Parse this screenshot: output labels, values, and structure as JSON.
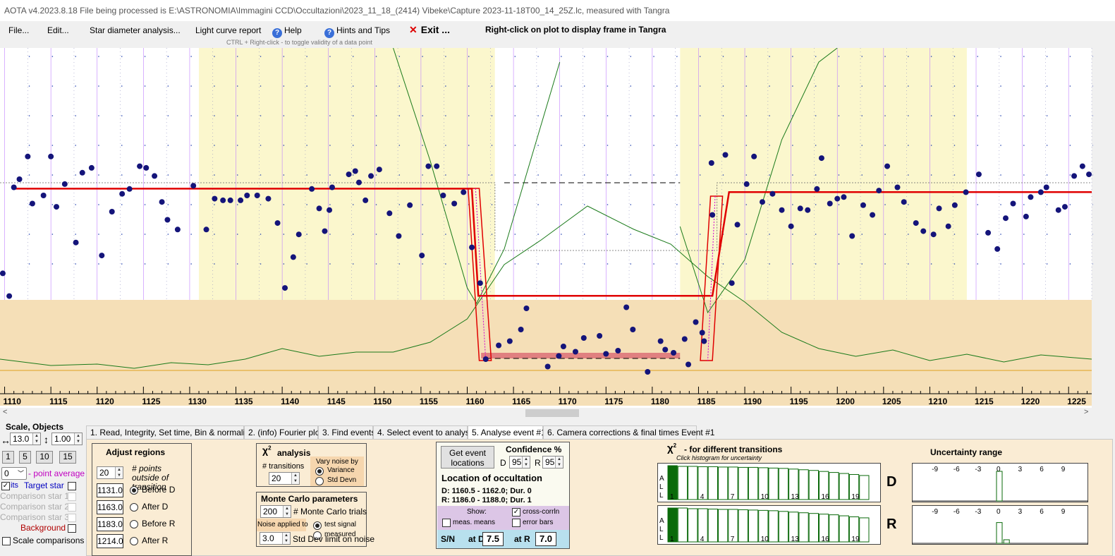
{
  "window": {
    "title": "AOTA v4.2023.8.18    File being processed is E:\\ASTRONOMIA\\Immagini CCD\\Occultazioni\\2023_11_18_(2414) Vibeke\\Capture 2023-11-18T00_14_25Z.lc, measured with Tangra"
  },
  "menu": {
    "file": "File...",
    "edit": "Edit...",
    "star_diameter": "Star diameter analysis...",
    "light_curve": "Light curve report",
    "help": "Help",
    "hints": "Hints and Tips",
    "exit": "Exit ...",
    "right_click": "Right-click on plot to display frame in Tangra",
    "ctrl_hint": "CTRL + Right-click  -  to toggle validity of a data point"
  },
  "colors": {
    "data_point": "#14147a",
    "fit_line": "#e00000",
    "background_curve": "#1a7a1a",
    "region_yellow": "#fbf7cd",
    "region_tan": "#f5dfb7",
    "event_bar": "#e08080"
  },
  "chart_data": {
    "type": "scatter",
    "xlim": [
      1109.5,
      1227.5
    ],
    "xticks": [
      1110,
      1115,
      1120,
      1125,
      1130,
      1135,
      1140,
      1145,
      1150,
      1155,
      1160,
      1165,
      1170,
      1175,
      1180,
      1185,
      1190,
      1195,
      1200,
      1205,
      1210,
      1215,
      1220,
      1225
    ],
    "points": [
      [
        1109.8,
        0.78
      ],
      [
        1110.5,
        0.92
      ],
      [
        1111,
        0.25
      ],
      [
        1111.6,
        0.2
      ],
      [
        1112.5,
        0.06
      ],
      [
        1113,
        0.35
      ],
      [
        1114.2,
        0.3
      ],
      [
        1115,
        0.06
      ],
      [
        1115.6,
        0.37
      ],
      [
        1116.5,
        0.23
      ],
      [
        1117.7,
        0.59
      ],
      [
        1118.4,
        0.16
      ],
      [
        1119.4,
        0.13
      ],
      [
        1120.5,
        0.67
      ],
      [
        1121.6,
        0.4
      ],
      [
        1122.7,
        0.29
      ],
      [
        1123.5,
        0.26
      ],
      [
        1124.6,
        0.12
      ],
      [
        1125.3,
        0.13
      ],
      [
        1126.2,
        0.18
      ],
      [
        1127,
        0.34
      ],
      [
        1127.6,
        0.45
      ],
      [
        1128.7,
        0.51
      ],
      [
        1130.4,
        0.24
      ],
      [
        1131.8,
        0.51
      ],
      [
        1132.7,
        0.32
      ],
      [
        1133.6,
        0.33
      ],
      [
        1134.4,
        0.33
      ],
      [
        1135.5,
        0.33
      ],
      [
        1136.2,
        0.3
      ],
      [
        1137.3,
        0.3
      ],
      [
        1138.5,
        0.32
      ],
      [
        1139.5,
        0.47
      ],
      [
        1140.3,
        0.87
      ],
      [
        1141.2,
        0.68
      ],
      [
        1141.8,
        0.54
      ],
      [
        1143.2,
        0.26
      ],
      [
        1144,
        0.38
      ],
      [
        1144.6,
        0.52
      ],
      [
        1145.1,
        0.39
      ],
      [
        1145.4,
        0.25
      ],
      [
        1147.2,
        0.17
      ],
      [
        1147.9,
        0.15
      ],
      [
        1148.3,
        0.22
      ],
      [
        1149,
        0.33
      ],
      [
        1149.6,
        0.18
      ],
      [
        1150.5,
        0.14
      ],
      [
        1151.6,
        0.41
      ],
      [
        1152.6,
        0.55
      ],
      [
        1153.8,
        0.36
      ],
      [
        1155.1,
        0.67
      ],
      [
        1155.8,
        0.12
      ],
      [
        1156.7,
        0.12
      ],
      [
        1157.4,
        0.3
      ],
      [
        1158.6,
        0.35
      ],
      [
        1159.6,
        0.28
      ],
      [
        1160.5,
        0.62
      ],
      [
        1161.4,
        0.84
      ],
      [
        1162,
        0.56
      ],
      [
        1163.4,
        0.43
      ],
      [
        1164.6,
        0.39
      ],
      [
        1165.8,
        0.28
      ],
      [
        1166.4,
        0.08
      ],
      [
        1168.7,
        0.63
      ],
      [
        1169.9,
        0.53
      ],
      [
        1170.4,
        0.44
      ],
      [
        1171.7,
        0.49
      ],
      [
        1172.6,
        0.36
      ],
      [
        1174.3,
        0.34
      ],
      [
        1175,
        0.51
      ],
      [
        1176.3,
        0.48
      ],
      [
        1177.2,
        0.07
      ],
      [
        1177.9,
        0.28
      ],
      [
        1179.5,
        0.68
      ],
      [
        1180.9,
        0.39
      ],
      [
        1181.4,
        0.47
      ],
      [
        1182.3,
        0.5
      ],
      [
        1183.5,
        0.37
      ],
      [
        1183.9,
        0.61
      ],
      [
        1184.7,
        0.21
      ],
      [
        1185.4,
        0.31
      ],
      [
        1185.6,
        0.39
      ],
      [
        1186.5,
        0.42
      ],
      [
        1186.4,
        0.1
      ],
      [
        1187.9,
        0.05
      ],
      [
        1188.6,
        0.84
      ],
      [
        1189.2,
        0.48
      ],
      [
        1190.2,
        0.23
      ],
      [
        1191,
        0.06
      ],
      [
        1191.9,
        0.34
      ],
      [
        1193,
        0.29
      ],
      [
        1194,
        0.39
      ],
      [
        1195,
        0.49
      ],
      [
        1196,
        0.38
      ],
      [
        1196.8,
        0.39
      ],
      [
        1197.8,
        0.26
      ],
      [
        1198.3,
        0.07
      ],
      [
        1199.2,
        0.35
      ],
      [
        1200,
        0.32
      ],
      [
        1200.7,
        0.31
      ],
      [
        1201.6,
        0.55
      ],
      [
        1202.8,
        0.36
      ],
      [
        1203.8,
        0.42
      ],
      [
        1204.5,
        0.27
      ],
      [
        1205.4,
        0.12
      ],
      [
        1206.5,
        0.25
      ],
      [
        1207.2,
        0.34
      ],
      [
        1208.5,
        0.47
      ],
      [
        1209.3,
        0.52
      ],
      [
        1210.4,
        0.54
      ],
      [
        1211,
        0.38
      ],
      [
        1212,
        0.49
      ],
      [
        1212.7,
        0.36
      ],
      [
        1213.9,
        0.28
      ],
      [
        1215.3,
        0.17
      ],
      [
        1216.3,
        0.53
      ],
      [
        1217.3,
        0.63
      ],
      [
        1218.2,
        0.44
      ],
      [
        1219,
        0.35
      ],
      [
        1220.4,
        0.43
      ],
      [
        1220.9,
        0.31
      ],
      [
        1222,
        0.28
      ],
      [
        1222.6,
        0.25
      ],
      [
        1223.9,
        0.39
      ],
      [
        1224.6,
        0.37
      ],
      [
        1225.6,
        0.18
      ],
      [
        1226.5,
        0.12
      ],
      [
        1227.2,
        0.17
      ]
    ],
    "red_fit": [
      [
        1110.8,
        0.26
      ],
      [
        1160.5,
        0.26
      ],
      [
        1161.2,
        0.57
      ],
      [
        1186.5,
        0.57
      ],
      [
        1188.3,
        0.27
      ],
      [
        1227.5,
        0.27
      ]
    ],
    "regions": [
      {
        "start": 1131,
        "end": 1163,
        "color": "yellow"
      },
      {
        "start": 1183,
        "end": 1214,
        "color": "yellow"
      }
    ]
  },
  "left": {
    "scale_objects": "Scale,  Objects",
    "scale_value": "13.0",
    "height_value": "1.00",
    "buttons": [
      "1",
      "5",
      "10",
      "15"
    ],
    "point_avg_value": "0",
    "point_avg_label": "- point average",
    "target": "Target star",
    "target_prefix": "its",
    "comp1": "Comparison star 1",
    "comp2": "Comparison star 2",
    "comp3": "Comparison star 3",
    "background": "Background",
    "scale_comparisons": "Scale comparisons"
  },
  "tabs": [
    "1.  Read, Integrity, Set time, Bin & normalise",
    "2. (info)  Fourier plot",
    "3. Find events",
    "4. Select event to analyse",
    "5. Analyse event #1",
    "6. Camera corrections & final times Event #1"
  ],
  "adjust": {
    "title": "Adjust regions",
    "points_value": "20",
    "points_label": "# points outside of transition",
    "rows": [
      {
        "value": "1131.0",
        "label": "Before D"
      },
      {
        "value": "1163.0",
        "label": "After D"
      },
      {
        "value": "1183.0",
        "label": "Before R"
      },
      {
        "value": "1214.0",
        "label": "After R"
      }
    ]
  },
  "chi": {
    "title": "analysis",
    "transitions_label": "# transitions",
    "transitions_value": "20",
    "vary_noise": "Vary noise by",
    "variance": "Variance",
    "std_devn": "Std Devn"
  },
  "monte": {
    "title": "Monte Carlo parameters",
    "trials_value": "200",
    "trials_label": "# Monte Carlo trials",
    "noise_applied": "Noise applied to",
    "test_signal": "test signal",
    "measured": "measured",
    "std_value": "3.0",
    "std_label": "Std Dev limit on noise"
  },
  "events": {
    "get_button": "Get event locations",
    "confidence": "Confidence %",
    "d_label": "D",
    "d_value": "95",
    "r_label": "R",
    "r_value": "95",
    "location_title": "Location of occultation",
    "d_line": "D: 1160.5 - 1162.0; Dur. 0",
    "r_line": "R: 1186.0 - 1188.0; Dur. 1",
    "show": "Show:",
    "cross_corrln": "cross-corrln",
    "meas_means": "meas. means",
    "error_bars": "error bars",
    "sn": "S/N",
    "at_d": "at D",
    "sn_d": "7.5",
    "at_r": "at R",
    "sn_r": "7.0"
  },
  "transitions": {
    "title": "- for different transitions",
    "subtitle": "Click histogram for uncertainty",
    "all_label": "A L L",
    "ticks": [
      "1",
      "4",
      "7",
      "10",
      "13",
      "16",
      "19"
    ],
    "d": "D",
    "r": "R",
    "d_hist": [
      1,
      0.98,
      0.98,
      0.97,
      0.97,
      0.96,
      0.96,
      0.95,
      0.95,
      0.94,
      0.93,
      0.92,
      0.9,
      0.88,
      0.86,
      0.83,
      0.8,
      0.77,
      0.74,
      0.71
    ],
    "r_hist": [
      1,
      1,
      0.98,
      0.98,
      0.97,
      0.96,
      0.96,
      0.95,
      0.94,
      0.93,
      0.92,
      0.9,
      0.88,
      0.86,
      0.84,
      0.82,
      0.8,
      0.77,
      0.74,
      0.71
    ]
  },
  "uncertainty": {
    "title": "Uncertainty range",
    "ticks": [
      "-9",
      "-6",
      "-3",
      "0",
      "3",
      "6",
      "9"
    ],
    "d_bars": [
      [
        0,
        1
      ]
    ],
    "r_bars": [
      [
        0,
        0.7
      ],
      [
        1,
        0.12
      ]
    ]
  }
}
